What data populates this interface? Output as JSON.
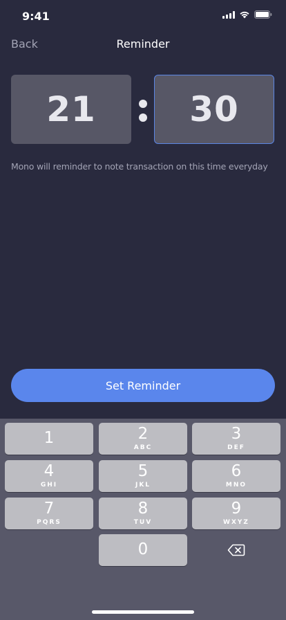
{
  "status_bar": {
    "time": "9:41",
    "icons": [
      "signal-icon",
      "wifi-icon",
      "battery-icon"
    ]
  },
  "nav": {
    "back_label": "Back",
    "title": "Reminder"
  },
  "time_picker": {
    "hour": "21",
    "separator": ":",
    "minute": "30"
  },
  "hint": "Mono will reminder to note transaction on this time everyday",
  "cta_label": "Set Reminder",
  "keypad": {
    "keys": [
      {
        "num": "1",
        "letters": ""
      },
      {
        "num": "2",
        "letters": "ABC"
      },
      {
        "num": "3",
        "letters": "DEF"
      },
      {
        "num": "4",
        "letters": "GHI"
      },
      {
        "num": "5",
        "letters": "JKL"
      },
      {
        "num": "6",
        "letters": "MNO"
      },
      {
        "num": "7",
        "letters": "PQRS"
      },
      {
        "num": "8",
        "letters": "TUV"
      },
      {
        "num": "9",
        "letters": "WXYZ"
      },
      {
        "num": "0",
        "letters": ""
      }
    ],
    "backspace_icon": "backspace-icon"
  },
  "colors": {
    "background": "#292a3e",
    "accent": "#5a86ec",
    "time_box": "#575766",
    "muted_text": "#a3a4b5",
    "keypad_bg": "#585869",
    "key_bg": "#bdbdc2"
  }
}
